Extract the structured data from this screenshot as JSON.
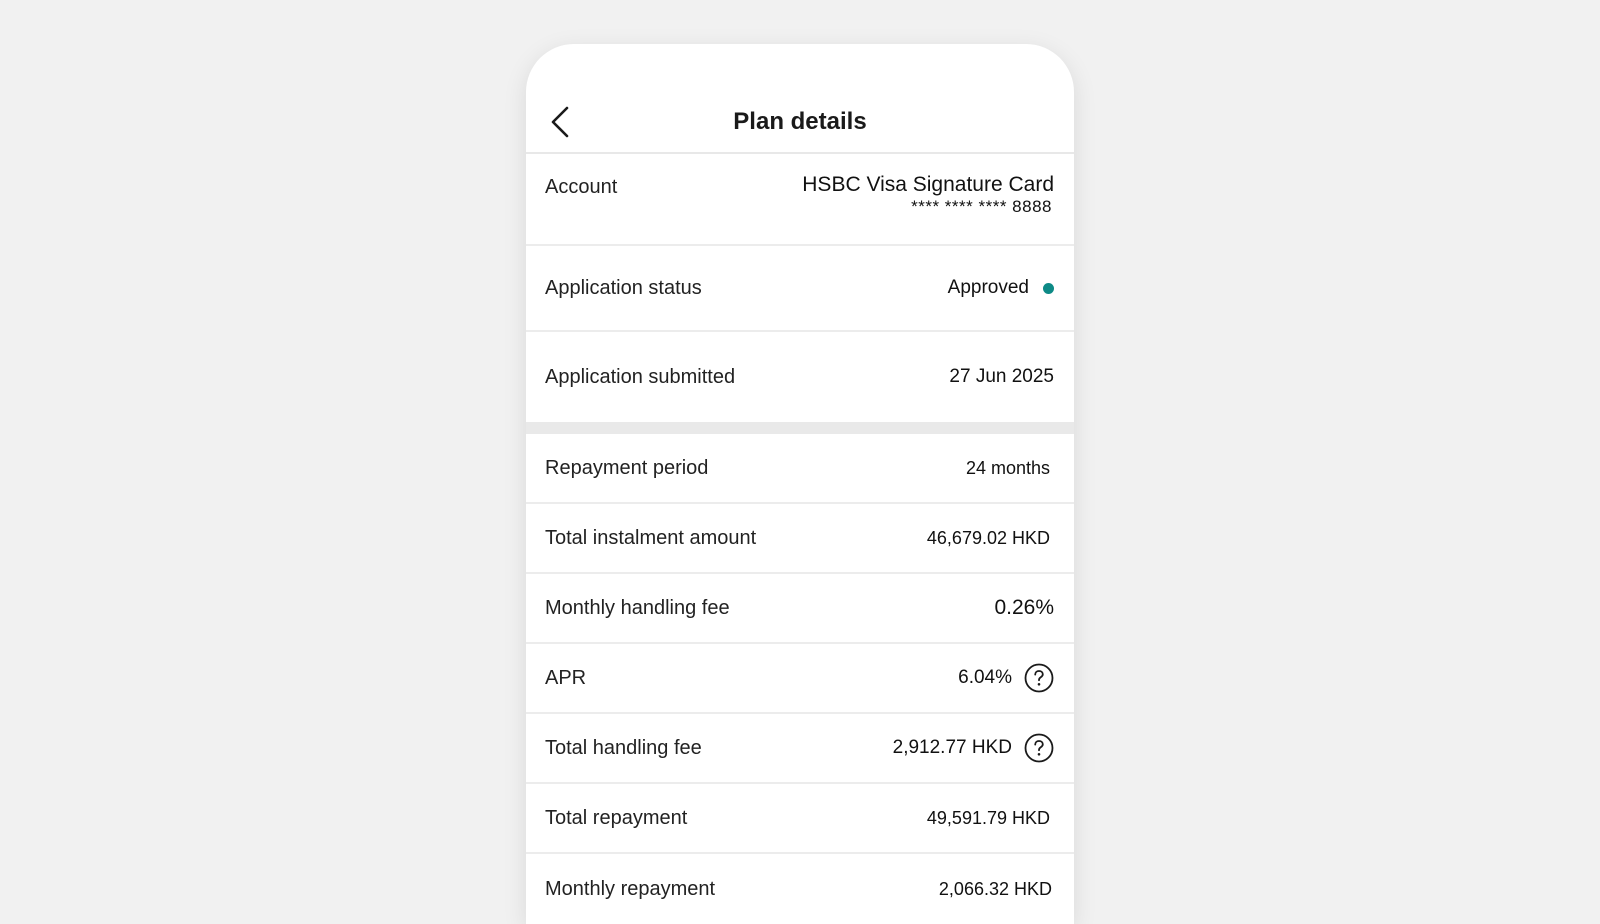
{
  "header": {
    "title": "Plan details",
    "back_icon": "chevron-left-icon"
  },
  "account": {
    "label": "Account",
    "card_name": "HSBC Visa Signature Card",
    "card_number": "**** **** **** 8888"
  },
  "status": {
    "label": "Application status",
    "value": "Approved",
    "dot_color": "#0d8a86"
  },
  "submitted": {
    "label": "Application submitted",
    "value": "27 Jun 2025"
  },
  "plan": {
    "repayment_period": {
      "label": "Repayment period",
      "value": "24 months"
    },
    "total_instalment": {
      "label": "Total instalment amount",
      "value": "46,679.02 HKD"
    },
    "monthly_fee": {
      "label": "Monthly handling fee",
      "value": "0.26%"
    },
    "apr": {
      "label": "APR",
      "value": "6.04%",
      "help_icon": "question-circle-icon"
    },
    "total_fee": {
      "label": "Total handling fee",
      "value": "2,912.77 HKD",
      "help_icon": "question-circle-icon"
    },
    "total_repayment": {
      "label": "Total repayment",
      "value": "49,591.79 HKD"
    },
    "monthly_repayment": {
      "label": "Monthly repayment",
      "value": "2,066.32 HKD"
    }
  }
}
